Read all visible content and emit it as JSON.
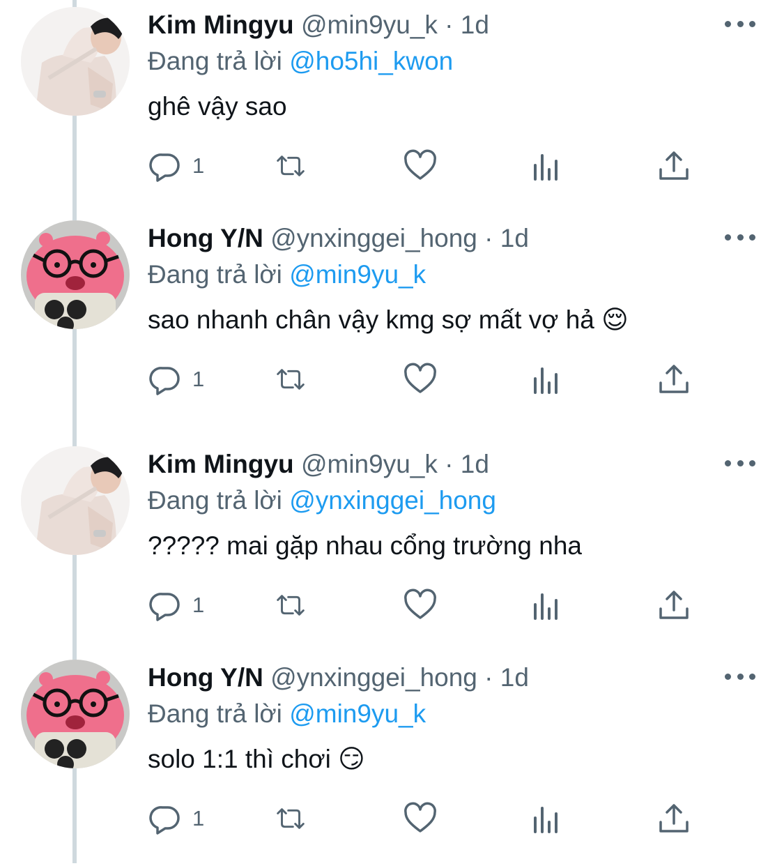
{
  "tweets": [
    {
      "name": "Kim Mingyu",
      "handle": "@min9yu_k",
      "separator": "·",
      "time": "1d",
      "replying_prefix": "Đang trả lời",
      "replying_to": "@ho5hi_kwon",
      "text": "ghê vậy sao",
      "reply_count": "1",
      "avatar": "mingyu-photo"
    },
    {
      "name": "Hong Y/N",
      "handle": "@ynxinggei_hong",
      "separator": "·",
      "time": "1d",
      "replying_prefix": "Đang trả lời",
      "replying_to": "@min9yu_k",
      "text": "sao nhanh chân vậy kmg sợ mất vợ hả 😌",
      "reply_count": "1",
      "avatar": "pink-plush-photo"
    },
    {
      "name": "Kim Mingyu",
      "handle": "@min9yu_k",
      "separator": "·",
      "time": "1d",
      "replying_prefix": "Đang trả lời",
      "replying_to": "@ynxinggei_hong",
      "text": "????? mai gặp nhau cổng trường nha",
      "reply_count": "1",
      "avatar": "mingyu-photo"
    },
    {
      "name": "Hong Y/N",
      "handle": "@ynxinggei_hong",
      "separator": "·",
      "time": "1d",
      "replying_prefix": "Đang trả lời",
      "replying_to": "@min9yu_k",
      "text": "solo 1:1 thì chơi 😏",
      "reply_count": "1",
      "avatar": "pink-plush-photo"
    }
  ],
  "icons": [
    "reply-icon",
    "retweet-icon",
    "like-icon",
    "views-icon",
    "share-icon",
    "more-icon"
  ],
  "colors": {
    "text": "#0f1419",
    "secondary": "#536471",
    "link": "#1d9bf0",
    "thread_line": "#cfd9de"
  }
}
